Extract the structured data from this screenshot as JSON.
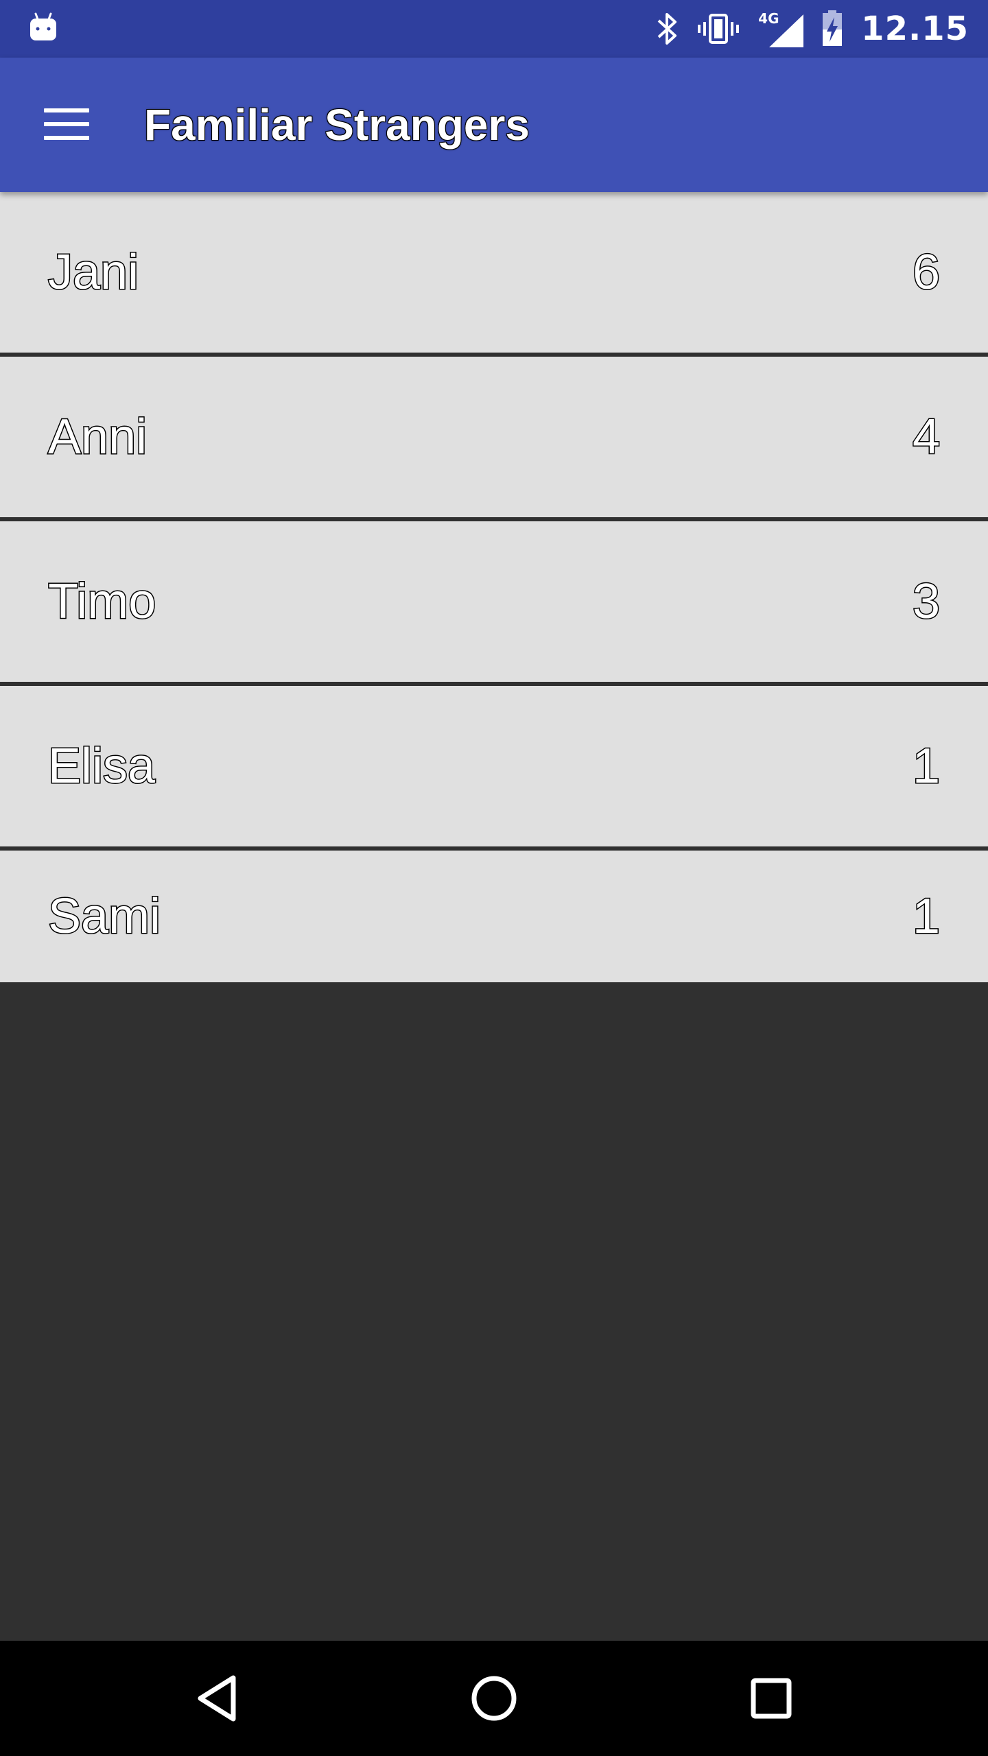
{
  "status_bar": {
    "time": "12.15",
    "network": "4G",
    "icons": [
      "android-robot-icon",
      "bluetooth-icon",
      "vibrate-icon",
      "signal-icon",
      "battery-charging-icon"
    ]
  },
  "app_bar": {
    "title": "Familiar Strangers",
    "menu_icon": "hamburger-menu-icon"
  },
  "list": {
    "items": [
      {
        "name": "Jani",
        "count": "6"
      },
      {
        "name": "Anni",
        "count": "4"
      },
      {
        "name": "Timo",
        "count": "3"
      },
      {
        "name": "Elisa",
        "count": "1"
      },
      {
        "name": "Sami",
        "count": "1"
      }
    ]
  },
  "nav_bar": {
    "icons": [
      "back-icon",
      "home-icon",
      "recents-icon"
    ]
  },
  "colors": {
    "status_bar": "#2f3f9e",
    "app_bar": "#3f51b5",
    "list_item_bg": "#e0e0e0",
    "background": "#303030",
    "nav_bar": "#000000"
  }
}
